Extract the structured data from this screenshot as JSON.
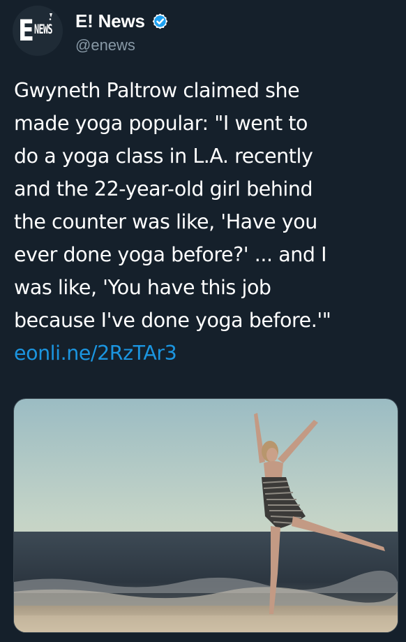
{
  "author": {
    "display_name": "E! News",
    "handle": "@enews",
    "verified": true,
    "avatar_icon": "e-news-logo",
    "avatar_logo_text": {
      "e": "E",
      "news": "NEWS"
    }
  },
  "tweet": {
    "lines": [
      "Gwyneth Paltrow claimed she",
      "made yoga popular: \"I went to",
      "do a yoga class in L.A. recently",
      "and the 22-year-old girl behind",
      "the counter was like, 'Have you",
      "ever done yoga before?' ... and I",
      "was like, 'You have this job",
      "because I've done yoga before.'\""
    ],
    "link_text": "eonli.ne/2RzTAr3"
  },
  "media": {
    "type": "photo",
    "description_icon": "yoga-beach-photo"
  },
  "colors": {
    "background": "#15202b",
    "text": "#ffffff",
    "secondary": "#8899a6",
    "link": "#1b95e0",
    "verified": "#1da1f2"
  }
}
